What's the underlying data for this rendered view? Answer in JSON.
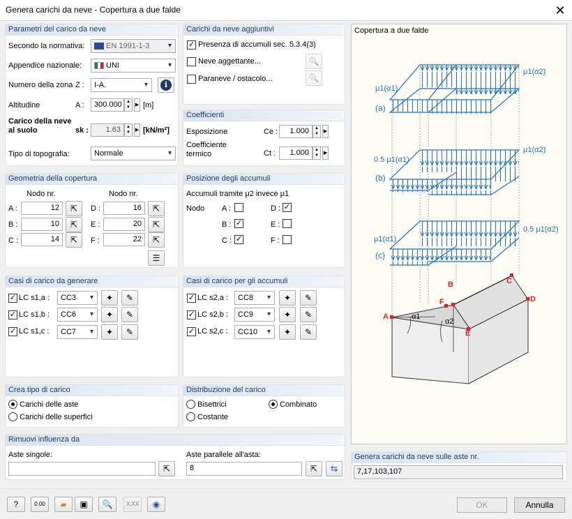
{
  "window": {
    "title": "Genera carichi da neve  -  Copertura a due falde",
    "close": "✕"
  },
  "params": {
    "header": "Parametri del carico da neve",
    "norm_label": "Secondo la normativa:",
    "norm_value": "EN 1991-1-3",
    "annex_label": "Appendice nazionale:",
    "annex_value": "UNI",
    "zone_label": "Numero della zona",
    "zone_sym": "Z :",
    "zone_value": "I-A.",
    "alt_label": "Altitudine",
    "alt_sym": "A :",
    "alt_value": "300.000",
    "alt_unit": "[m]",
    "load_label1": "Carico della neve",
    "load_label2": "al suolo",
    "load_sym": "sk :",
    "load_value": "1.63",
    "load_unit": "[kN/m²]",
    "topo_label": "Tipo di topografia:",
    "topo_value": "Normale"
  },
  "extra": {
    "header": "Carichi da neve aggiuntivi",
    "opt1": "Presenza di accumuli sec. 5.3.4(3)",
    "opt2": "Neve aggettante...",
    "opt3": "Paraneve / ostacolo..."
  },
  "coeff": {
    "header": "Coefficienti",
    "exp_label": "Esposizione",
    "exp_sym": "Ce :",
    "exp_value": "1.000",
    "therm_label1": "Coefficiente",
    "therm_label2": "termico",
    "therm_sym": "Ct :",
    "therm_value": "1.000"
  },
  "geom": {
    "header": "Geometria della copertura",
    "col1": "Nodo nr.",
    "col2": "Nodo nr.",
    "A": "12",
    "B": "10",
    "C": "14",
    "D": "16",
    "E": "20",
    "F": "22",
    "lA": "A :",
    "lB": "B :",
    "lC": "C :",
    "lD": "D :",
    "lE": "E :",
    "lF": "F :"
  },
  "drift": {
    "header": "Posizione degli accumuli",
    "sub": "Accumuli tramite μ2 invece μ1",
    "node": "Nodo",
    "lA": "A :",
    "lB": "B :",
    "lC": "C :",
    "lD": "D :",
    "lE": "E :",
    "lF": "F :"
  },
  "lc_gen": {
    "header": "Casi di carico da generare",
    "r1": "LC s1,a :",
    "v1": "CC3",
    "r2": "LC s1,b :",
    "v2": "CC6",
    "r3": "LC s1,c :",
    "v3": "CC7"
  },
  "lc_drift": {
    "header": "Casi di carico per gli accumuli",
    "r1": "LC s2,a :",
    "v1": "CC8",
    "r2": "LC s2,b :",
    "v2": "CC9",
    "r3": "LC s2,c :",
    "v3": "CC10"
  },
  "loadtype": {
    "header": "Crea tipo di carico",
    "o1": "Carichi delle aste",
    "o2": "Carichi delle superfici"
  },
  "distrib": {
    "header": "Distribuzione del carico",
    "o1": "Bisettrici",
    "o2": "Combinato",
    "o3": "Costante"
  },
  "remove": {
    "header": "Rimuovi influenza da",
    "single_label": "Aste singole:",
    "single_value": "",
    "parallel_label": "Aste parallele all'asta:",
    "parallel_value": "8"
  },
  "diagram": {
    "title": "Copertura a due falde",
    "a": "(a)",
    "b": "(b)",
    "c": "(c)",
    "mu1a1": "μ1(α1)",
    "mu1a2": "μ1(α2)",
    "half_mu1a1": "0.5 μ1(α1)",
    "half_mu1a2": "0.5 μ1(α2)",
    "A": "A",
    "B": "B",
    "C": "C",
    "D": "D",
    "E": "E",
    "F": "F",
    "alpha1": "α1",
    "alpha2": "α2"
  },
  "members": {
    "header": "Genera carichi da neve sulle aste nr.",
    "value": "7,17,103,107"
  },
  "footer": {
    "ok": "OK",
    "cancel": "Annulla"
  }
}
